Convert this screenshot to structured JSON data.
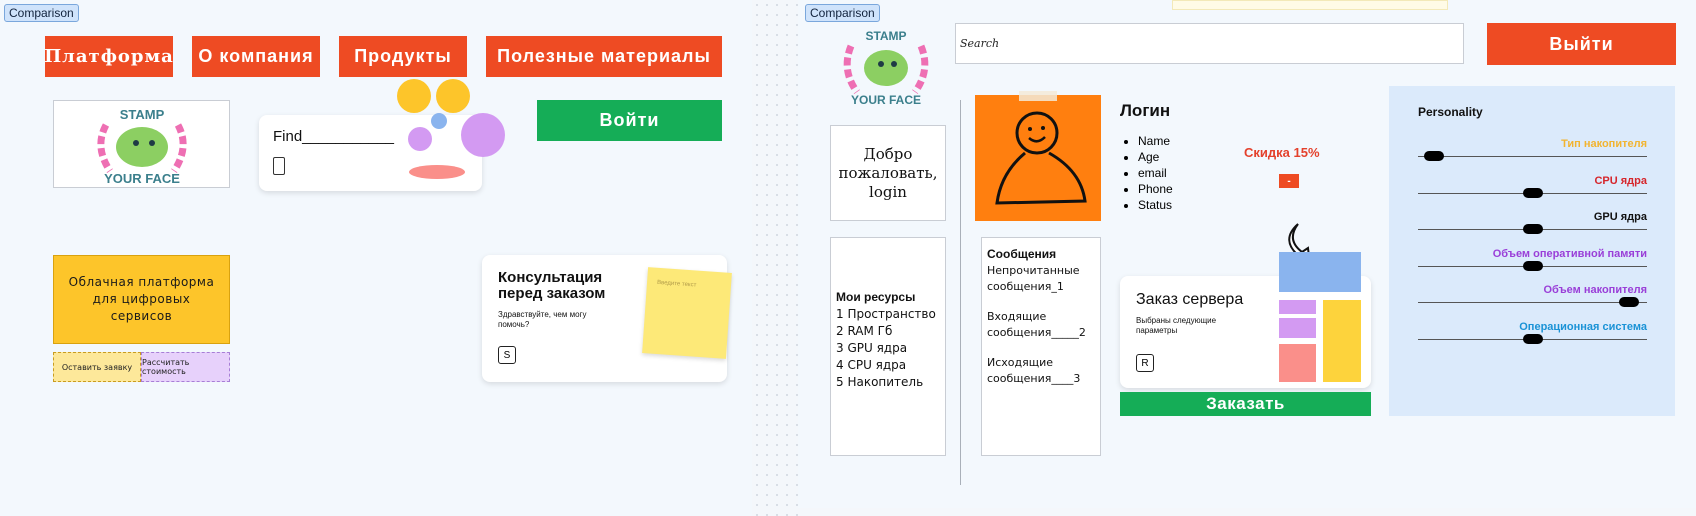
{
  "left": {
    "tag": "Comparison",
    "nav": [
      "Платформа",
      "О компания",
      "Продукты",
      "Полезные материалы"
    ],
    "login_label": "Войти",
    "find_label": "Find___________",
    "cloud_text": "Облачная платформа для цифровых сервисов",
    "apply_label": "Оставить заявку",
    "calc_label": "Рассчитать стоимость",
    "consult_title": "Консультация перед заказом",
    "consult_sub": "Здравствуйте, чем могу помочь?",
    "consult_badge": "S",
    "sticky_note": "Введите текст"
  },
  "right": {
    "tag": "Comparison",
    "search_value": "Search",
    "logout_label": "Выйти",
    "welcome": "Добро пожаловать, login",
    "login_title": "Логин",
    "profile_fields": [
      "Name",
      "Age",
      "email",
      "Phone",
      "Status"
    ],
    "discount": "Скидка 15%",
    "discount_btn": "-",
    "resources_title": "Мои ресурсы",
    "resources": [
      "1 Пространство",
      "2 RAM Гб",
      "3 GPU ядра",
      "4 CPU ядра",
      "5 Накопитель"
    ],
    "messages_title": "Сообщения",
    "messages": [
      "Непрочитанные сообщения_1",
      "Входящие сообщения_____2",
      "Исходящие сообщения____3"
    ],
    "order_title": "Заказ сервера",
    "order_sub": "Выбраны следующие параметры",
    "order_badge": "R",
    "order_btn": "Заказать",
    "personality_title": "Personality",
    "sliders": [
      {
        "label": "Тип накопителя",
        "color": "#f2b430",
        "value": 0.07
      },
      {
        "label": "CPU ядра",
        "color": "#d6262b",
        "value": 0.5
      },
      {
        "label": "GPU ядра",
        "color": "#111111",
        "value": 0.5
      },
      {
        "label": "Объем оперативной памяти",
        "color": "#9a3fd8",
        "value": 0.5
      },
      {
        "label": "Объем накопителя",
        "color": "#9a3fd8",
        "value": 0.92
      },
      {
        "label": "Операционная система",
        "color": "#1b93d6",
        "value": 0.5
      }
    ]
  },
  "logo": {
    "top": "STAMP",
    "bottom": "YOUR FACE"
  },
  "colors": {
    "red": "#ee4b23",
    "green": "#15ad57",
    "yellow": "#fdc52a",
    "orange": "#ff7f0f",
    "lightblue": "#dbeafb"
  }
}
